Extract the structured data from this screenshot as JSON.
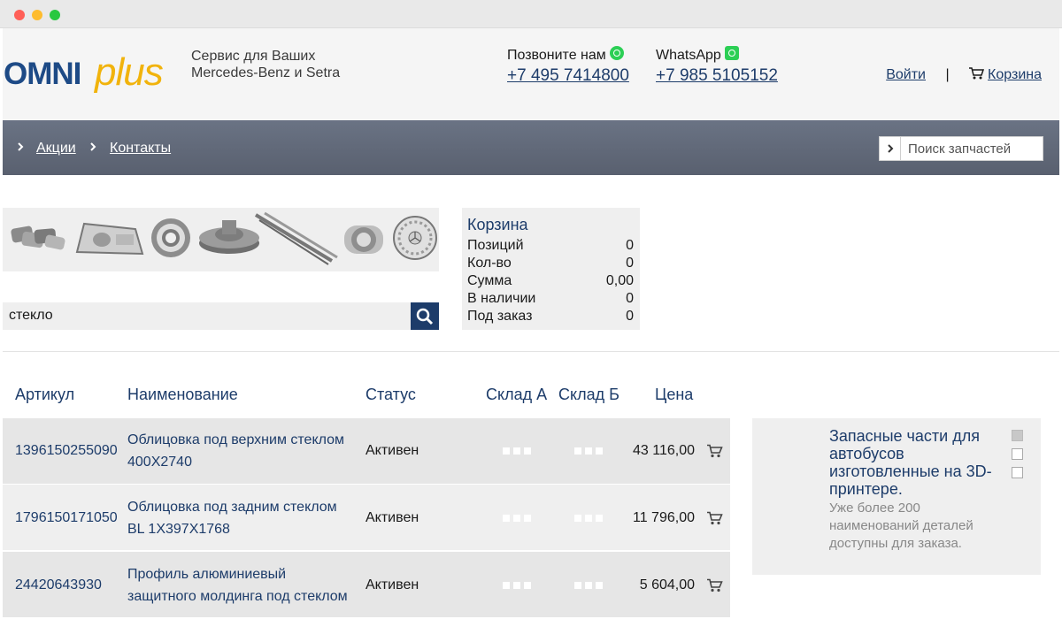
{
  "header": {
    "logo": {
      "part1": "OMNI",
      "part2": "plus"
    },
    "tagline": [
      "Сервис для Ваших",
      "Mercedes-Benz и Setra"
    ],
    "phone": {
      "label": "Позвоните нам",
      "number": "+7 495 7414800"
    },
    "whatsapp": {
      "label": "WhatsApp",
      "number": "+7 985 5105152"
    },
    "login": "Войти",
    "separator": "|",
    "cart": "Корзина"
  },
  "nav": {
    "items": [
      "Акции",
      "Контакты"
    ],
    "search_placeholder": "Поиск запчастей"
  },
  "search": {
    "value": "стекло"
  },
  "cart_box": {
    "title": "Корзина",
    "rows": [
      {
        "label": "Позиций",
        "value": "0"
      },
      {
        "label": "Кол-во",
        "value": "0"
      },
      {
        "label": "Сумма",
        "value": "0,00"
      },
      {
        "label": "В наличии",
        "value": "0"
      },
      {
        "label": "Под заказ",
        "value": "0"
      }
    ]
  },
  "table": {
    "headers": {
      "article": "Артикул",
      "name": "Наименование",
      "status": "Статус",
      "stock_a": "Склад А",
      "stock_b": "Склад Б",
      "price": "Цена"
    },
    "rows": [
      {
        "article": "1396150255090",
        "name_l1": "Облицовка под верхним стеклом",
        "name_l2": "400X2740",
        "status": "Активен",
        "price": "43 116,00"
      },
      {
        "article": "1796150171050",
        "name_l1": "Облицовка под задним стеклом",
        "name_l2": "BL 1X397X1768",
        "status": "Активен",
        "price": "11 796,00"
      },
      {
        "article": "24420643930",
        "name_l1": "Профиль алюминиевый",
        "name_l2": "защитного молдинга под стеклом",
        "status": "Активен",
        "price": "5 604,00"
      }
    ]
  },
  "promo": {
    "title": "Запасные части для автобусов изготовленные на 3D-принтере.",
    "description": "Уже более 200 наименований деталей доступны для заказа.",
    "slides": [
      true,
      false,
      false
    ]
  },
  "colors": {
    "brand_blue": "#1d3c6a",
    "brand_yellow": "#f1b30c",
    "nav_bg": "#636b7a"
  }
}
